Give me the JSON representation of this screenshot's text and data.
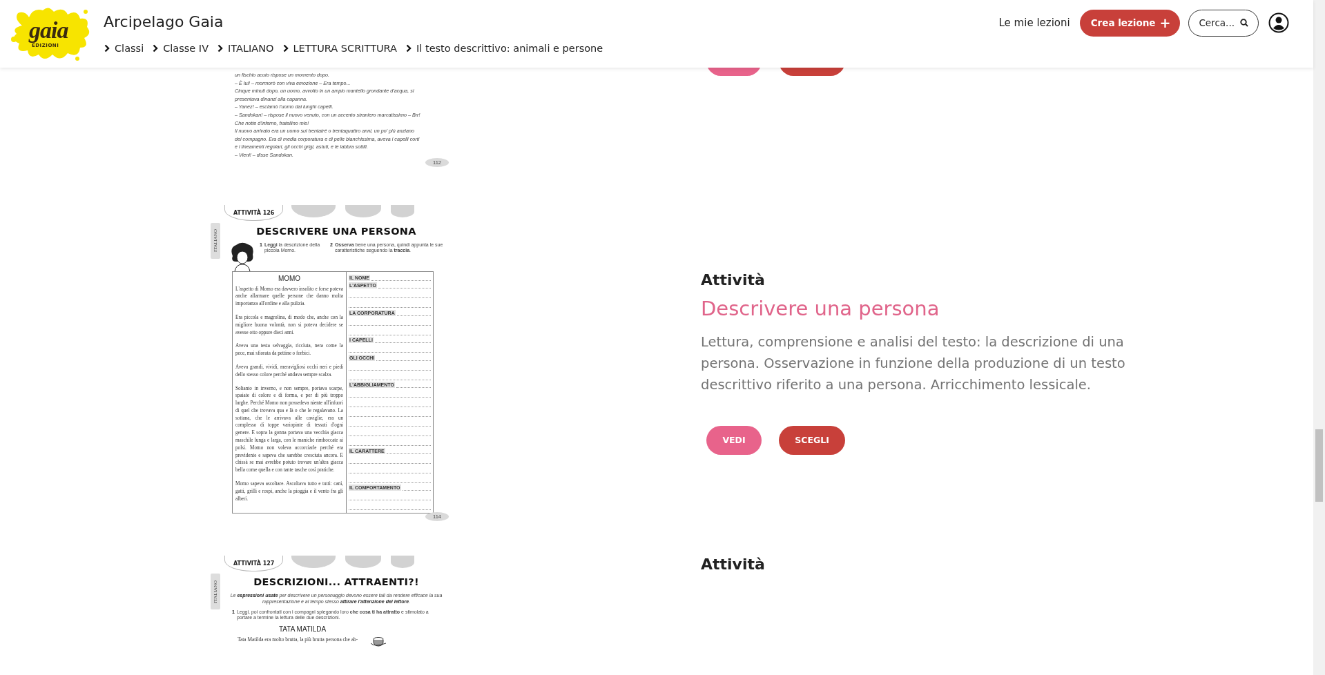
{
  "header": {
    "logo": {
      "name": "gaia",
      "sub": "EDIZIONI"
    },
    "title": "Arcipelago Gaia",
    "breadcrumb": [
      "Classi",
      "Classe IV",
      "ITALIANO",
      "LETTURA SCRITTURA",
      "Il testo descrittivo: animali e persone"
    ],
    "my_lessons": "Le mie lezioni",
    "create_button": {
      "label": "Crea lezione",
      "icon": "+"
    },
    "search_button": "Cerca..."
  },
  "activities": [
    {
      "worksheet": {
        "kind": "text",
        "lines": [
          "un fischio acuto rispose un momento dopo.",
          "– È lui! – mormorò con viva emozione – Era tempo...",
          "Cinque minuti dopo, un uomo, avvolto in un ampio mantello grondante d'acqua, si",
          "presentava dinanzi alla capanna.",
          "– Yanez! – esclamò l'uomo dai lunghi capelli.",
          "– Sandokan! – rispose il nuovo venuto, con un accento straniero marcatissimo – Brr!",
          "Che notte d'inferno, fratellino mio!",
          "Il nuovo arrivato era un uomo sui trentatré o trentaquattro anni, un po' più anziano",
          "del compagno. Era di media corporatura e di pelle bianchissima, aveva i capelli corti",
          "e i lineamenti regolari, gli occhi grigi, astuti, e le labbra sottili.",
          "– Vieni! – disse Sandokan."
        ],
        "page": "112"
      },
      "buttons": [
        {
          "kind": "view"
        },
        {
          "kind": "choose"
        }
      ]
    },
    {
      "worksheet": {
        "kind": "form",
        "tag": "ATTIVITÀ 126",
        "side": "ITALIANO",
        "title": "DESCRIVERE UNA PERSONA",
        "steps": [
          {
            "number": "1",
            "text": "**Leggi** la descrizione della piccola Momo."
          },
          {
            "number": "2",
            "text": "**Osserva** bene una persona, quindi appunta le sue caratteristiche seguendo la **traccia**."
          }
        ],
        "story_title": "MOMO",
        "paragraphs": [
          "L'aspetto di Momo era davvero insolito e forse poteva anche allarmare quelle persone che danno molta importanza all'ordine e alla pulizia.",
          "Era piccola e magrolina, di modo che, anche con la migliore buona volontà, non si poteva decidere se avesse otto oppure dieci anni.",
          "Aveva una testa selvaggia, ricciuta, nera come la pece, mai sfiorata da pettine o forbici.",
          "Aveva grandi, vividi, meravigliosi occhi neri e piedi dello stesso colore perché andava sempre scalza.",
          "Soltanto in inverno, e non sempre, portava scarpe, spaiate di colore e di forma, e per di più troppo larghe. Perché Momo non possedeva niente all'infuori di quel che trovava qua e là o che le regalavano. La sottana, che le arrivava alle caviglie, era un complesso di toppe variopinte di tessuti d'ogni genere. E sopra la gonna portava una vecchia giacca maschile lunga e larga, con le maniche rimboccate ai polsi. Momo non voleva accorciarle perché era previdente e sapeva che sarebbe cresciuta ancora. E chissà se mai avrebbe potuto trovare un'altra giacca bella come quella e con tante tasche così pratiche.",
          "Momo sapeva ascoltare. Ascoltava tutto e tutti: cani, gatti, grilli e rospi, anche la pioggia e il vento fra gli alberi."
        ],
        "fields": [
          "IL NOME",
          "L'ASPETTO",
          "LA CORPORATURA",
          "I CAPELLI",
          "GLI OCCHI",
          "L'ABBIGLIAMENTO",
          "IL CARATTERE",
          "IL COMPORTAMENTO"
        ],
        "page": "114"
      },
      "label": "Attività",
      "title": "Descrivere una persona",
      "description": "Lettura, comprensione e analisi del testo: la descrizione di una persona. Osservazione in funzione della produzione di un testo descrittivo riferito a una persona. Arricchimento lessicale.",
      "buttons": [
        {
          "kind": "view",
          "label": "VEDI"
        },
        {
          "kind": "choose",
          "label": "SCEGLI"
        }
      ]
    },
    {
      "worksheet": {
        "kind": "intro",
        "tag": "ATTIVITÀ 127",
        "side": "ITALIANO",
        "title": "DESCRIZIONI... ATTRAENTI?!",
        "intro": "Le **espressioni usate** per descrivere un personaggio devono essere tali da rendere efficace la sua rappresentazione e al tempo stesso **attirare l'attenzione del lettore**.",
        "steps": [
          {
            "number": "1",
            "text": "Leggi, poi confrontati con i compagni spiegando loro **che cosa ti ha attratto** e stimolato a portare a termine la lettura delle due descrizioni."
          }
        ],
        "story_title": "TATA MATILDA",
        "paragraphs": [
          "Tata Matilda era molto brutta, la più brutta persona che ab-"
        ]
      },
      "label": "Attività"
    }
  ]
}
